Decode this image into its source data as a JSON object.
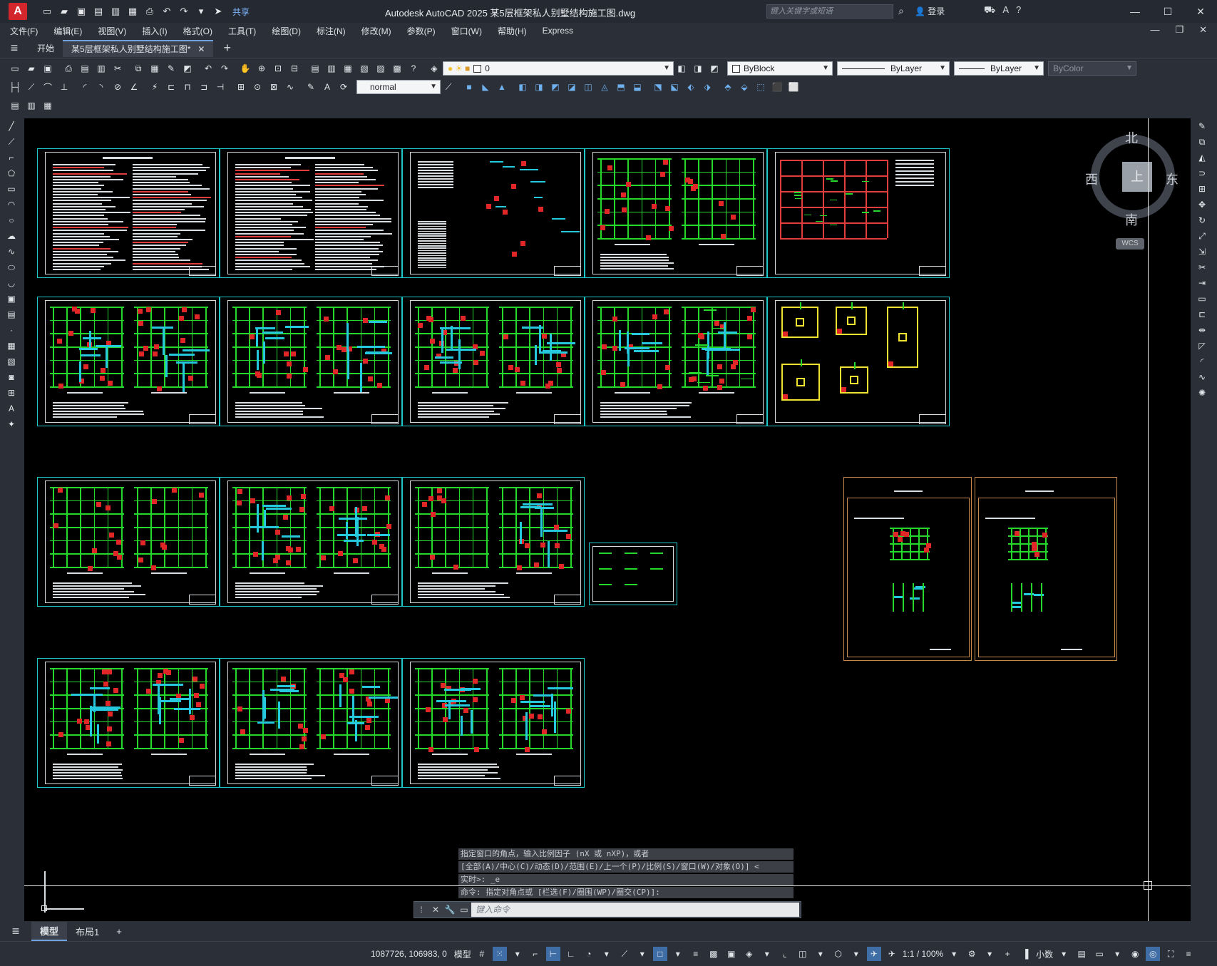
{
  "app": {
    "logo_letter": "A",
    "title": "Autodesk AutoCAD 2025    某5层框架私人别墅结构施工图.dwg",
    "share_label": "共享",
    "search_placeholder": "键入关键字或短语",
    "login_label": "登录"
  },
  "menu": [
    "文件(F)",
    "编辑(E)",
    "视图(V)",
    "插入(I)",
    "格式(O)",
    "工具(T)",
    "绘图(D)",
    "标注(N)",
    "修改(M)",
    "参数(P)",
    "窗口(W)",
    "帮助(H)",
    "Express"
  ],
  "tabs": {
    "start": "开始",
    "document": "某5层框架私人别墅结构施工图*"
  },
  "toolbar": {
    "layer_value": "0",
    "text_style": "normal",
    "color": "ByBlock",
    "linetype": "ByLayer",
    "lineweight": "ByLayer",
    "plotstyle": "ByColor"
  },
  "viewcube": {
    "north": "北",
    "south": "南",
    "east": "东",
    "west": "西",
    "top_face": "上",
    "wcs": "WCS"
  },
  "command": {
    "history": [
      "指定窗口的角点，输入比例因子 (nX 或 nXP)，或者",
      "[全部(A)/中心(C)/动态(D)/范围(E)/上一个(P)/比例(S)/窗口(W)/对象(O)] <",
      "实时>: _e",
      "命令: 指定对角点或 [栏选(F)/圈围(WP)/圈交(CP)]:"
    ],
    "placeholder": "键入命令"
  },
  "layout_tabs": [
    "模型",
    "布局1"
  ],
  "status": {
    "coordinates": "1087726, 106983, 0",
    "model_label": "模型",
    "scale": "1:1 / 100%",
    "units": "小数"
  },
  "colors": {
    "sheet_border": "#1fc8c8",
    "grid_green": "#27d82c",
    "column_red": "#e02626",
    "beam_cyan": "#25c8dd",
    "foundation_yellow": "#f0e230",
    "accent_blue": "#3f6ea6"
  }
}
